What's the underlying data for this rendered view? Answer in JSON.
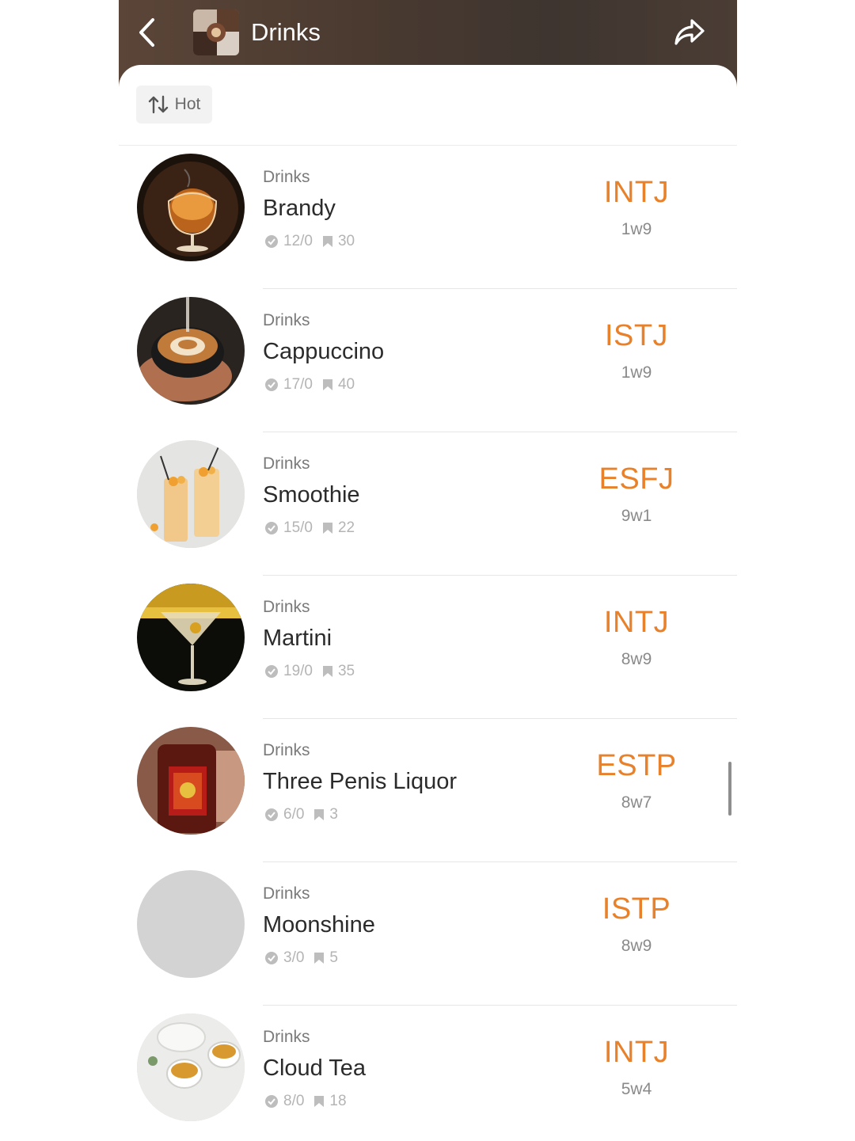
{
  "header": {
    "title": "Drinks",
    "back_icon": "chevron-left-icon",
    "share_icon": "share-icon"
  },
  "sort": {
    "label": "Hot",
    "icon": "sort-arrows-icon"
  },
  "colors": {
    "accent": "#e8812a",
    "header_bg": "#4a3a30"
  },
  "items": [
    {
      "category": "Drinks",
      "name": "Brandy",
      "votes": "12/0",
      "bookmarks": "30",
      "mbti": "INTJ",
      "enneagram": "1w9",
      "image": "brandy-glass"
    },
    {
      "category": "Drinks",
      "name": "Cappuccino",
      "votes": "17/0",
      "bookmarks": "40",
      "mbti": "ISTJ",
      "enneagram": "1w9",
      "image": "cappuccino-cup"
    },
    {
      "category": "Drinks",
      "name": "Smoothie",
      "votes": "15/0",
      "bookmarks": "22",
      "mbti": "ESFJ",
      "enneagram": "9w1",
      "image": "smoothie-glasses"
    },
    {
      "category": "Drinks",
      "name": "Martini",
      "votes": "19/0",
      "bookmarks": "35",
      "mbti": "INTJ",
      "enneagram": "8w9",
      "image": "martini-glass"
    },
    {
      "category": "Drinks",
      "name": "Three Penis Liquor",
      "votes": "6/0",
      "bookmarks": "3",
      "mbti": "ESTP",
      "enneagram": "8w7",
      "image": "liquor-bottle"
    },
    {
      "category": "Drinks",
      "name": "Moonshine",
      "votes": "3/0",
      "bookmarks": "5",
      "mbti": "ISTP",
      "enneagram": "8w9",
      "image": "placeholder"
    },
    {
      "category": "Drinks",
      "name": "Cloud Tea",
      "votes": "8/0",
      "bookmarks": "18",
      "mbti": "INTJ",
      "enneagram": "5w4",
      "image": "tea-cups"
    }
  ]
}
